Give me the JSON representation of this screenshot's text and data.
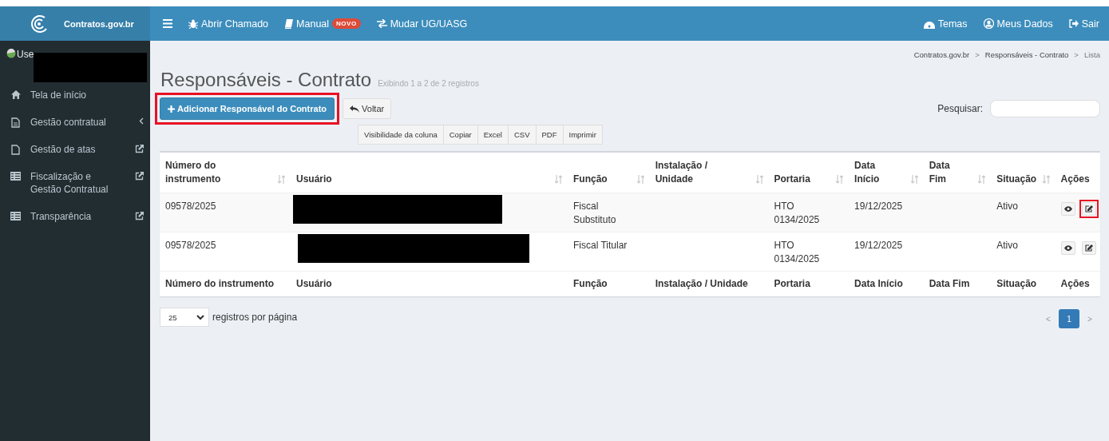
{
  "brand": {
    "name": "Contratos.gov.br"
  },
  "topbar": {
    "left": [
      {
        "kind": "menu"
      },
      {
        "kind": "bug",
        "label": "Abrir Chamado"
      },
      {
        "kind": "book",
        "label": "Manual",
        "badge": "NOVO"
      },
      {
        "kind": "swap",
        "label": "Mudar UG/UASG"
      }
    ],
    "right": [
      {
        "kind": "palette",
        "label": "Temas"
      },
      {
        "kind": "user",
        "label": "Meus Dados"
      },
      {
        "kind": "exit",
        "label": "Sair"
      }
    ]
  },
  "sidebar": {
    "user": {
      "label": "Use",
      "redacted": true
    },
    "items": [
      {
        "kind": "home",
        "label": "Tela de início"
      },
      {
        "kind": "doc",
        "label": "Gestão contratual",
        "trail": {
          "kind": "caret"
        }
      },
      {
        "kind": "file",
        "label": "Gestão de atas",
        "trail": {
          "kind": "external"
        }
      },
      {
        "kind": "list",
        "label": "Fiscalização e Gestão Contratual",
        "trail": {
          "kind": "external"
        }
      },
      {
        "kind": "list",
        "label": "Transparência",
        "trail": {
          "kind": "external"
        }
      }
    ]
  },
  "breadcrumb": {
    "items": [
      "Contratos.gov.br",
      "Responsáveis - Contrato",
      "Lista"
    ],
    "separators": [
      ">",
      ">"
    ]
  },
  "page": {
    "title": "Responsáveis - Contrato",
    "subtitle": "Exibindo 1 a 2 de 2 registros"
  },
  "actions": {
    "add": {
      "label": "Adicionar Responsável do Contrato",
      "highlighted": true
    },
    "back": {
      "label": "Voltar"
    }
  },
  "export_buttons": [
    "Visibilidade da coluna",
    "Copiar",
    "Excel",
    "CSV",
    "PDF",
    "Imprimir"
  ],
  "search": {
    "label": "Pesquisar:"
  },
  "table": {
    "columns": [
      {
        "label": "Número do instrumento",
        "sortable": true
      },
      {
        "label": "Usuário",
        "sortable": true
      },
      {
        "label": "Função",
        "sortable": true
      },
      {
        "label": "Instalação / Unidade",
        "sortable": true
      },
      {
        "label": "Portaria",
        "sortable": true
      },
      {
        "label": "Data Início",
        "sortable": true
      },
      {
        "label": "Data Fim",
        "sortable": true
      },
      {
        "label": "Situação",
        "sortable": true
      },
      {
        "label": "Ações",
        "sortable": false
      }
    ],
    "footer": [
      "Número do instrumento",
      "Usuário",
      "Função",
      "Instalação / Unidade",
      "Portaria",
      "Data Início",
      "Data Fim",
      "Situação",
      "Ações"
    ],
    "rows": [
      {
        "cells": [
          "09578/2025",
          {
            "redacted": true
          },
          "Fiscal Substituto",
          "",
          "HTO 0134/2025",
          "19/12/2025",
          "",
          "Ativo"
        ],
        "actions": [
          {
            "kind": "view",
            "highlighted": false
          },
          {
            "kind": "edit",
            "highlighted": true
          }
        ]
      },
      {
        "cells": [
          "09578/2025",
          {
            "redacted": true
          },
          "Fiscal Titular",
          "",
          "HTO 0134/2025",
          "19/12/2025",
          "",
          "Ativo"
        ],
        "actions": [
          {
            "kind": "view",
            "highlighted": false
          },
          {
            "kind": "edit",
            "highlighted": false
          }
        ]
      }
    ]
  },
  "page_size": {
    "value": "25",
    "label": "registros por página"
  },
  "pagination": [
    {
      "label": "<",
      "selected": false
    },
    {
      "label": "1",
      "selected": true
    },
    {
      "label": ">",
      "selected": false
    }
  ]
}
